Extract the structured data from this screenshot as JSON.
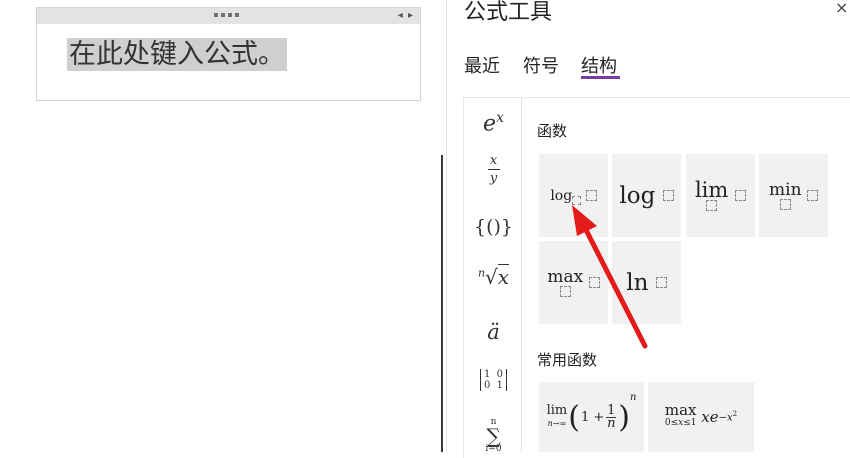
{
  "equation": {
    "placeholder": "在此处键入公式。",
    "nav_arrows": "◂ ▸"
  },
  "pane": {
    "title": "公式工具",
    "close_glyph": "×",
    "tabs": [
      {
        "label": "最近",
        "active": false
      },
      {
        "label": "符号",
        "active": false
      },
      {
        "label": "结构",
        "active": true
      }
    ],
    "accent_color": "#7a3aa0"
  },
  "categories": [
    {
      "icon": "script-icon"
    },
    {
      "icon": "fraction-icon"
    },
    {
      "icon": "bracket-icon"
    },
    {
      "icon": "radical-icon"
    },
    {
      "icon": "accent-icon"
    },
    {
      "icon": "matrix-icon"
    },
    {
      "icon": "large-operator-icon"
    }
  ],
  "sections": {
    "functions": {
      "label": "函数",
      "items": [
        "log",
        "log",
        "lim",
        "min",
        "max",
        "ln"
      ]
    },
    "common_functions": {
      "label": "常用函数",
      "items": [
        "lim",
        "max"
      ]
    }
  },
  "annotation": {
    "color": "#e31b1b",
    "icon": "red-arrow-icon"
  }
}
